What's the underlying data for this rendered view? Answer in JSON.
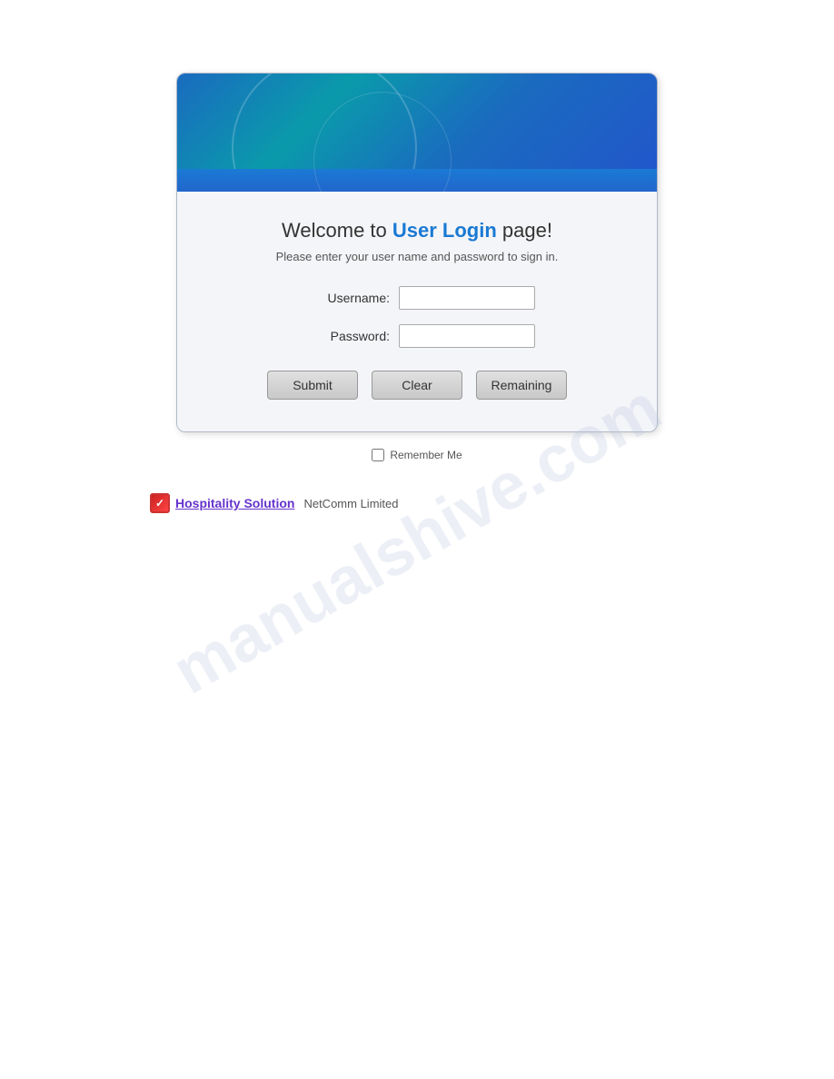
{
  "watermark": "manualshive.com",
  "card": {
    "title_prefix": "Welcome to ",
    "title_highlight": "User Login",
    "title_suffix": " page!",
    "subtitle": "Please enter your user name and password  to sign in.",
    "username_label": "Username:",
    "password_label": "Password:",
    "username_placeholder": "",
    "password_placeholder": "",
    "buttons": {
      "submit": "Submit",
      "clear": "Clear",
      "remaining": "Remaining"
    },
    "remember_me": "Remember Me"
  },
  "footer": {
    "logo_text": "✓",
    "link_text": "Hospitality Solution",
    "company_text": "NetComm Limited"
  }
}
